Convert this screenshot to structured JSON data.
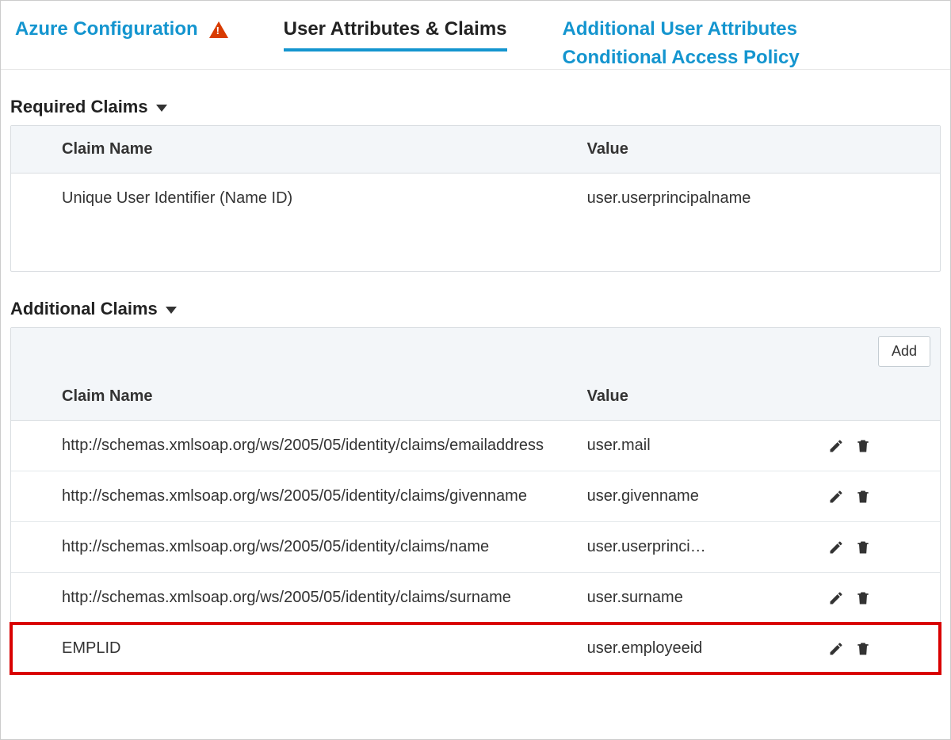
{
  "tabs": {
    "azure": "Azure Configuration",
    "claims": "User Attributes & Claims",
    "additional_attrs": "Additional User Attributes",
    "conditional": "Conditional Access Policy"
  },
  "sections": {
    "required": "Required Claims",
    "additional": "Additional Claims"
  },
  "headers": {
    "claim_name": "Claim Name",
    "value": "Value"
  },
  "buttons": {
    "add": "Add"
  },
  "required_claims": [
    {
      "name": "Unique User Identifier (Name ID)",
      "value": "user.userprincipalname"
    }
  ],
  "additional_claims": [
    {
      "name": "http://schemas.xmlsoap.org/ws/2005/05/identity/claims/emailaddress",
      "value": "user.mail"
    },
    {
      "name": "http://schemas.xmlsoap.org/ws/2005/05/identity/claims/givenname",
      "value": "user.givenname"
    },
    {
      "name": "http://schemas.xmlsoap.org/ws/2005/05/identity/claims/name",
      "value": "user.userprinci…"
    },
    {
      "name": "http://schemas.xmlsoap.org/ws/2005/05/identity/claims/surname",
      "value": "user.surname"
    },
    {
      "name": "EMPLID",
      "value": "user.employeeid",
      "highlight": true
    }
  ]
}
